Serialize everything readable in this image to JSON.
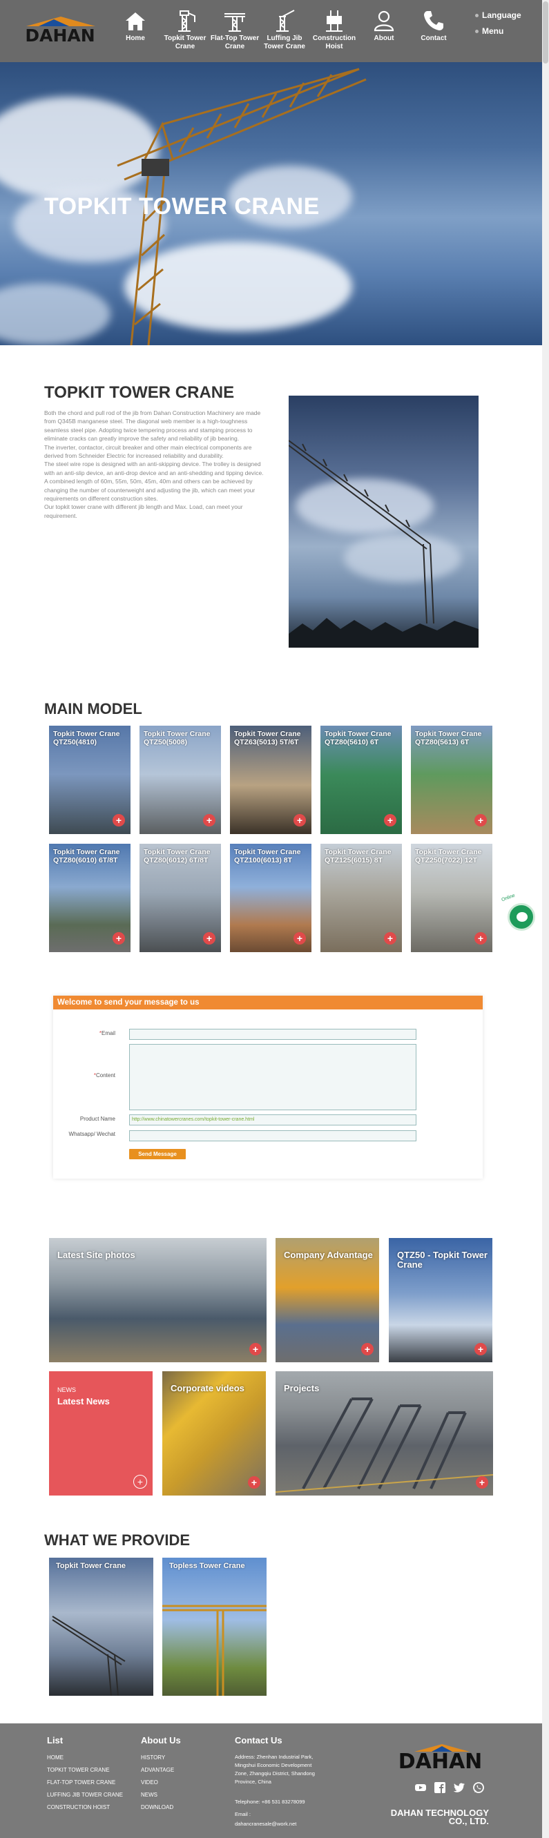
{
  "header": {
    "logo_text": "DAHAN",
    "nav": [
      {
        "label": "Home",
        "icon": "home-icon"
      },
      {
        "label": "Topkit Tower Crane",
        "icon": "tower-crane-icon"
      },
      {
        "label": "Flat-Top Tower Crane",
        "icon": "flat-top-crane-icon"
      },
      {
        "label": "Luffing Jib Tower Crane",
        "icon": "luffing-crane-icon"
      },
      {
        "label": "Construction Hoist",
        "icon": "hoist-icon"
      },
      {
        "label": "About",
        "icon": "user-icon"
      },
      {
        "label": "Contact",
        "icon": "phone-icon"
      }
    ],
    "language": "Language",
    "menu": "Menu"
  },
  "hero": {
    "title": "TOPKIT TOWER CRANE"
  },
  "intro": {
    "title": "TOPKIT TOWER CRANE",
    "paragraphs": [
      "Both the chord and pull rod of the jib from Dahan Construction Machinery are made from Q345B manganese steel. The diagonal web member is a high-toughness seamless steel pipe. Adopting twice tempering process and stamping process to eliminate cracks can greatly improve the safety and reliability of jib bearing.",
      "The inverter, contactor, circuit breaker and other main electrical components are derived from Schneider Electric for increased reliability and durability.",
      "The steel wire rope is designed with an anti-skipping device. The trolley is designed with an anti-slip device, an anti-drop device and an anti-shedding and tipping device.",
      "A combined length of 60m, 55m, 50m, 45m, 40m and others can be achieved by changing the number of counterweight and adjusting the jib, which can meet your requirements on different construction sites.",
      "Our topkit tower crane with different jib length and Max. Load, can meet your requirement."
    ]
  },
  "main_model": {
    "title": "MAIN MODEL",
    "items": [
      {
        "line1": "Topkit Tower Crane",
        "line2": "QTZ50(4810)"
      },
      {
        "line1": "Topkit Tower Crane",
        "line2": "QTZ50(5008)"
      },
      {
        "line1": "Topkit Tower Crane",
        "line2": "QTZ63(5013) 5T/6T"
      },
      {
        "line1": "Topkit Tower Crane",
        "line2": "QTZ80(5610) 6T"
      },
      {
        "line1": "Topkit Tower Crane",
        "line2": "QTZ80(5613) 6T"
      },
      {
        "line1": "Topkit Tower Crane",
        "line2": "QTZ80(6010) 6T/8T"
      },
      {
        "line1": "Topkit Tower Crane",
        "line2": "QTZ80(6012) 6T/8T"
      },
      {
        "line1": "Topkit Tower Crane",
        "line2": "QTZ100(6013) 8T"
      },
      {
        "line1": "Topkit Tower Crane",
        "line2": "QTZ125(6015) 8T"
      },
      {
        "line1": "Topkit Tower Crane",
        "line2": "QTZ250(7022) 12T"
      }
    ]
  },
  "form": {
    "heading": "Welcome to send your message to us",
    "email_label": "Email",
    "content_label": "Content",
    "product_label": "Product Name",
    "product_value": "http://www.chinatowercranes.com/topkit-tower-crane.html",
    "whatsapp_label": "Whatsapp/ Wechat",
    "send_label": "Send Message"
  },
  "tiles": {
    "site_photos": "Latest Site photos",
    "advantage": "Company Advantage",
    "qtz50": "QTZ50 - Topkit Tower Crane",
    "news_small": "NEWS",
    "news_big": "Latest News",
    "videos": "Corporate videos",
    "projects": "Projects"
  },
  "provide": {
    "title": "WHAT WE PROVIDE",
    "items": [
      "Topkit Tower Crane",
      "Topless Tower Crane"
    ]
  },
  "footer": {
    "list_title": "List",
    "list_links": [
      "HOME",
      "TOPKIT TOWER CRANE",
      "FLAT-TOP TOWER CRANE",
      "LUFFING JIB TOWER CRANE",
      "CONSTRUCTION HOIST"
    ],
    "about_title": "About Us",
    "about_links": [
      "HISTORY",
      "ADVANTAGE",
      "VIDEO",
      "NEWS",
      "DOWNLOAD"
    ],
    "contact_title": "Contact Us",
    "address": "Address: Zhenhan Industrial Park, Mingshui Economic Development Zone, Zhangqiu District, Shandong Province, China",
    "telephone": "Telephone: +86 531 83278099",
    "email_label": "Email :",
    "email": "dahancranesale@work.net",
    "logo_text": "DAHAN",
    "company": "DAHAN TECHNOLOGY CO., LTD.",
    "social": [
      "youtube-icon",
      "facebook-icon",
      "twitter-icon",
      "whatsapp-icon"
    ]
  },
  "chat": {
    "tag": "Online"
  }
}
